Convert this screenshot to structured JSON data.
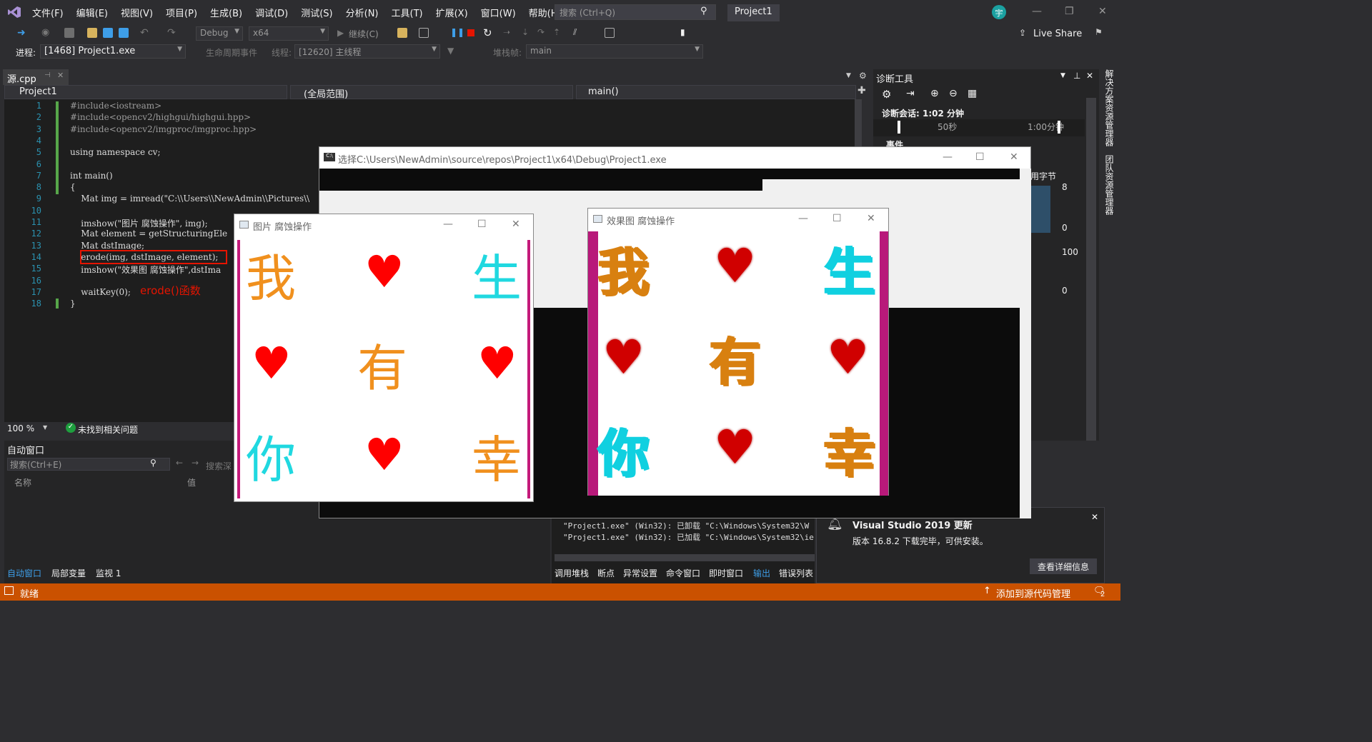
{
  "menu": [
    "文件(F)",
    "编辑(E)",
    "视图(V)",
    "项目(P)",
    "生成(B)",
    "调试(D)",
    "测试(S)",
    "分析(N)",
    "工具(T)",
    "扩展(X)",
    "窗口(W)",
    "帮助(H)"
  ],
  "search": {
    "placeholder": "搜索 (Ctrl+Q)"
  },
  "project_title": "Project1",
  "avatar": "宇",
  "live_share": "Live Share",
  "toolbar": {
    "config": "Debug",
    "platform": "x64",
    "continue": "继续(C)"
  },
  "debugbar": {
    "process_label": "进程:",
    "process": "[1468] Project1.exe",
    "lifecycle": "生命周期事件",
    "thread_label": "线程:",
    "thread": "[12620] 主线程",
    "stack_label": "堆栈帧:",
    "stack": "main"
  },
  "editor": {
    "tab": "源.cpp",
    "nav_project": "Project1",
    "nav_scope": "(全局范围)",
    "nav_func": "main()",
    "zoom": "100 %",
    "issues": "未找到相关问题",
    "annotation": "erode()函数",
    "lines": [
      {
        "n": "1",
        "t": "#include<iostream>"
      },
      {
        "n": "2",
        "t": "#include<opencv2/highgui/highgui.hpp>"
      },
      {
        "n": "3",
        "t": "#include<opencv2/imgproc/imgproc.hpp>"
      },
      {
        "n": "4",
        "t": ""
      },
      {
        "n": "5",
        "t": "using namespace cv;"
      },
      {
        "n": "6",
        "t": ""
      },
      {
        "n": "7",
        "t": "int main()"
      },
      {
        "n": "8",
        "t": "{"
      },
      {
        "n": "9",
        "t": "    Mat img = imread(\"C:\\\\Users\\\\NewAdmin\\\\Pictures\\\\"
      },
      {
        "n": "10",
        "t": ""
      },
      {
        "n": "11",
        "t": "    imshow(\"图片 腐蚀操作\", img);"
      },
      {
        "n": "12",
        "t": "    Mat element = getStructuringEle"
      },
      {
        "n": "13",
        "t": "    Mat dstImage;"
      },
      {
        "n": "14",
        "t": "    erode(img, dstImage, element);"
      },
      {
        "n": "15",
        "t": "    imshow(\"效果图 腐蚀操作\",dstIma"
      },
      {
        "n": "16",
        "t": ""
      },
      {
        "n": "17",
        "t": "    waitKey(0);"
      },
      {
        "n": "18",
        "t": "}"
      }
    ]
  },
  "diagnostics": {
    "title": "诊断工具",
    "session": "诊断会话: 1:02 分钟",
    "tick1": "50秒",
    "tick2": "1:00分钟",
    "events": "事件",
    "bytes": "用字节",
    "v8": "8",
    "v0": "0",
    "v100": "100",
    "v0b": "0"
  },
  "right_tabs": [
    "解决方案资源管理器",
    "团队资源管理器"
  ],
  "console": {
    "title": "选择C:\\Users\\NewAdmin\\source\\repos\\Project1\\x64\\Debug\\Project1.exe"
  },
  "window1": {
    "title": "图片 腐蚀操作",
    "cells": [
      "我",
      "♥",
      "生",
      "♥",
      "有",
      "♥",
      "你",
      "♥",
      "幸"
    ]
  },
  "window2": {
    "title": "效果图 腐蚀操作",
    "cells": [
      "我",
      "♥",
      "生",
      "♥",
      "有",
      "♥",
      "你",
      "♥",
      "幸"
    ]
  },
  "autos": {
    "title": "自动窗口",
    "search": "搜索(Ctrl+E)",
    "search_depth": "搜索深",
    "col_name": "名称",
    "col_value": "值",
    "tabs": [
      "自动窗口",
      "局部变量",
      "监视 1"
    ]
  },
  "output": {
    "lines": [
      "\"Project1.exe\" (Win32): 已卸载 \"C:\\Windows\\System32\\W",
      "\"Project1.exe\" (Win32): 已加载 \"C:\\Windows\\System32\\ie"
    ],
    "tabs": [
      "调用堆栈",
      "断点",
      "异常设置",
      "命令窗口",
      "即时窗口",
      "输出",
      "错误列表"
    ]
  },
  "notification": {
    "title": "Visual Studio 2019 更新",
    "body": "版本 16.8.2 下载完毕，可供安装。",
    "button": "查看详细信息"
  },
  "status": {
    "ready": "就绪",
    "source_control": "添加到源代码管理",
    "badge": "2"
  },
  "colors": {
    "accent": "#007acc",
    "status": "#ca5100",
    "annotation": "#e51400"
  }
}
